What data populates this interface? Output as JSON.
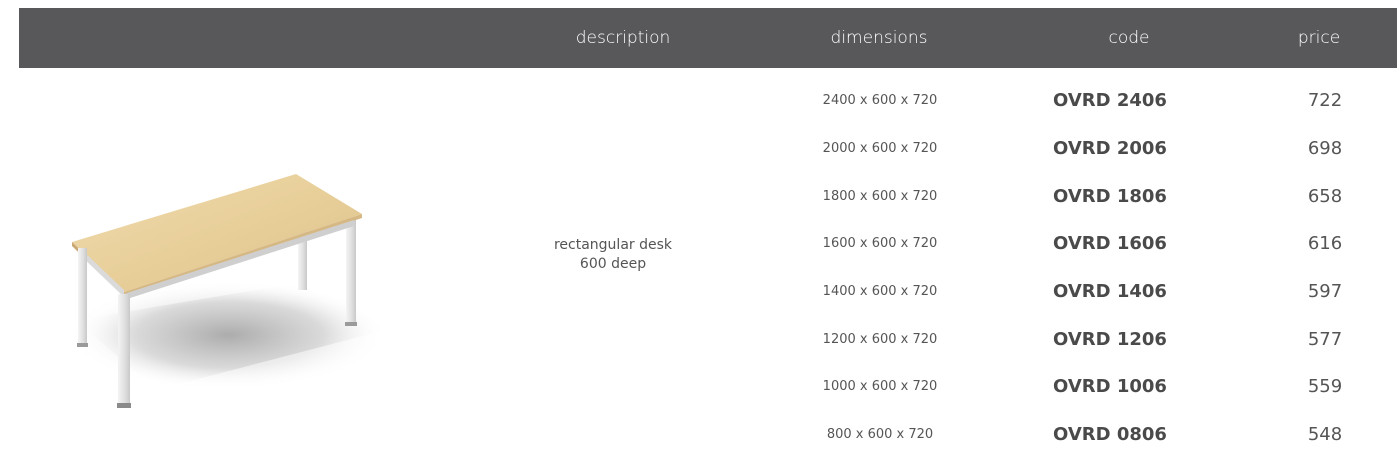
{
  "header": {
    "description": "description",
    "dimensions": "dimensions",
    "code": "code",
    "price": "price"
  },
  "product": {
    "description_line1": "rectangular desk",
    "description_line2": "600 deep"
  },
  "rows": [
    {
      "dimensions": "2400 x 600 x 720",
      "code": "OVRD 2406",
      "price": "722"
    },
    {
      "dimensions": "2000 x 600 x 720",
      "code": "OVRD 2006",
      "price": "698"
    },
    {
      "dimensions": "1800 x 600 x 720",
      "code": "OVRD 1806",
      "price": "658"
    },
    {
      "dimensions": "1600 x 600 x 720",
      "code": "OVRD 1606",
      "price": "616"
    },
    {
      "dimensions": "1400 x 600 x 720",
      "code": "OVRD 1406",
      "price": "597"
    },
    {
      "dimensions": "1200 x 600 x 720",
      "code": "OVRD 1206",
      "price": "577"
    },
    {
      "dimensions": "1000 x 600 x 720",
      "code": "OVRD 1006",
      "price": "559"
    },
    {
      "dimensions": "800 x 600 x 720",
      "code": "OVRD 0806",
      "price": "548"
    }
  ],
  "colors": {
    "header_bg": "#58585a",
    "desktop_wood": "#e8cf9a",
    "frame": "#e6e6e6"
  }
}
